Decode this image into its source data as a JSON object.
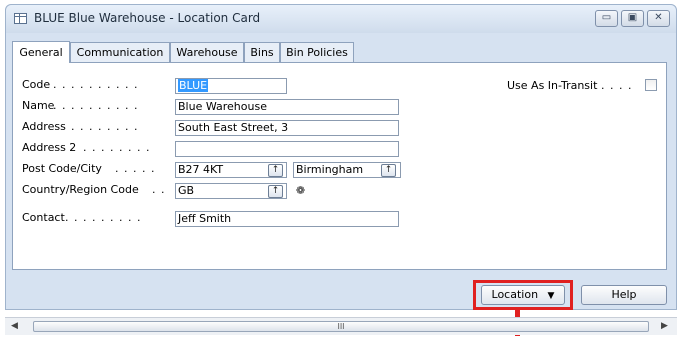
{
  "window": {
    "title": "BLUE Blue Warehouse - Location Card",
    "minimize_glyph": "▭",
    "maximize_glyph": "▣",
    "close_glyph": "✕"
  },
  "tabs": [
    {
      "label": "General",
      "active": true
    },
    {
      "label": "Communication",
      "active": false
    },
    {
      "label": "Warehouse",
      "active": false
    },
    {
      "label": "Bins",
      "active": false
    },
    {
      "label": "Bin Policies",
      "active": false
    }
  ],
  "fields": {
    "code": {
      "label": "Code",
      "dots": ". . . . . . . . . .",
      "value": "BLUE"
    },
    "name": {
      "label": "Name",
      "dots": ". . . . . . . . . .",
      "value": "Blue Warehouse"
    },
    "address": {
      "label": "Address",
      "dots": ". . . . . . . .",
      "value": "South East Street, 3"
    },
    "address2": {
      "label": "Address 2",
      "dots": ". . . . . . . .",
      "value": ""
    },
    "post_code_city": {
      "label": "Post Code/City",
      "dots": ". . . . .",
      "post_code": "B27 4KT",
      "city": "Birmingham"
    },
    "country": {
      "label": "Country/Region Code",
      "dots": ". .",
      "value": "GB"
    },
    "contact": {
      "label": "Contact",
      "dots": ". . . . . . . . .",
      "value": "Jeff Smith"
    },
    "use_as_in_transit": {
      "label": "Use As In-Transit",
      "dots": ". . . .",
      "checked": false
    }
  },
  "icons": {
    "lookup": "lookup-arrow-icon",
    "country_assist": "country-assist-icon"
  },
  "buttons": {
    "location": "Location",
    "help": "Help"
  },
  "scrollbar": {
    "grip": "III"
  },
  "colors": {
    "highlight": "#e02020",
    "selection": "#3399ff"
  }
}
